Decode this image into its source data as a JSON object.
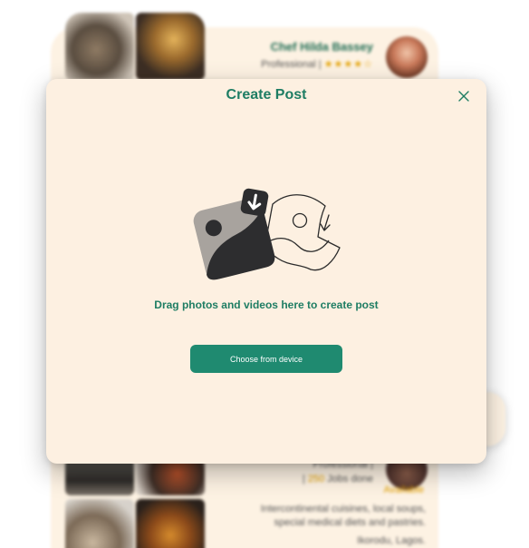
{
  "profile": {
    "chef_name": "Chef Hilda Bassey",
    "role": "Professional |",
    "stars": "★★★★☆",
    "jobs_count": "250",
    "jobs_label": "Jobs done",
    "availability": "Available",
    "description": "Intercontinental cuisines, local soups, special medical diets and pastries.",
    "location": "Ikorodu, Lagos."
  },
  "modal": {
    "title": "Create Post",
    "prompt": "Drag photos and videos here to create post",
    "choose_button": "Choose from device"
  },
  "colors": {
    "accent": "#1f8a70",
    "title_green": "#1e7d63",
    "modal_bg": "#fdf0e1",
    "star": "#e3a100"
  },
  "icons": {
    "close": "close-icon",
    "upload": "media-upload-icon"
  }
}
